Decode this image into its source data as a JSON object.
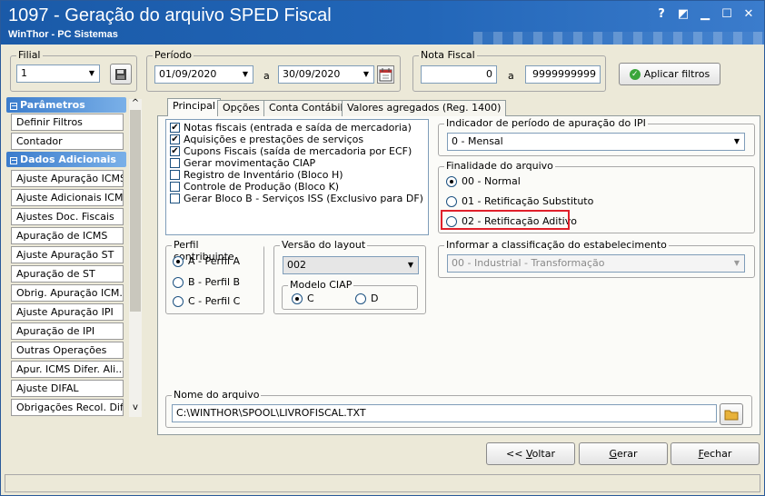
{
  "window": {
    "title": "1097 - Geração do arquivo SPED Fiscal",
    "subtitle": "WinThor - PC Sistemas",
    "help_glyph": "?",
    "restore_glyph": "◩",
    "min_glyph": "▁",
    "max_glyph": "☐",
    "close_glyph": "✕"
  },
  "filial": {
    "legend": "Filial",
    "value": "1"
  },
  "periodo": {
    "legend": "Período",
    "start": "01/09/2020",
    "sep": "a",
    "end": "30/09/2020"
  },
  "nota_fiscal": {
    "legend": "Nota Fiscal",
    "start": "0",
    "sep": "a",
    "end": "9999999999"
  },
  "apply_filters": {
    "label": "Aplicar filtros"
  },
  "sidebar": {
    "section1": "Parâmetros",
    "section1_items": [
      "Definir Filtros",
      "Contador"
    ],
    "section2": "Dados Adicionais",
    "section2_items": [
      "Ajuste Apuração ICMS",
      "Ajuste Adicionais ICMS",
      "Ajustes Doc. Fiscais",
      "Apuração de ICMS",
      "Ajuste Apuração ST",
      "Apuração de ST",
      "Obrig. Apuração ICM...",
      "Ajuste Apuração IPI",
      "Apuração de IPI",
      "Outras Operações",
      "Apur. ICMS Difer. Ali...",
      "Ajuste DIFAL",
      "Obrigações Recol. Difal"
    ]
  },
  "tabs": [
    "Principal",
    "Opções",
    "Conta Contábil",
    "Valores agregados (Reg. 1400)"
  ],
  "checklist": [
    {
      "label": "Notas fiscais (entrada e saída de mercadoria)",
      "checked": true
    },
    {
      "label": "Aquisições e prestações de serviços",
      "checked": true
    },
    {
      "label": "Cupons Fiscais (saída de mercadoria por ECF)",
      "checked": true
    },
    {
      "label": "Gerar movimentação CIAP",
      "checked": false
    },
    {
      "label": "Registro de Inventário (Bloco H)",
      "checked": false
    },
    {
      "label": "Controle de Produção (Bloco K)",
      "checked": false
    },
    {
      "label": "Gerar Bloco B - Serviços ISS (Exclusivo para DF)",
      "checked": false
    }
  ],
  "indicador_ipi": {
    "legend": "Indicador de período de apuração do IPI",
    "value": "0 - Mensal"
  },
  "finalidade": {
    "legend": "Finalidade do arquivo",
    "options": [
      "00 - Normal",
      "01 - Retificação Substituto",
      "02 - Retificação Aditivo"
    ],
    "selected": 0
  },
  "perfil": {
    "legend": "Perfil contribuinte",
    "options": [
      "A - Perfil A",
      "B - Perfil B",
      "C - Perfil C"
    ],
    "selected": 0
  },
  "versao_layout": {
    "legend": "Versão do layout",
    "value": "002"
  },
  "modelo_ciap": {
    "legend": "Modelo CIAP",
    "options": [
      "C",
      "D"
    ],
    "selected": 0
  },
  "classificacao": {
    "legend": "Informar a classificação do estabelecimento",
    "value": "00 - Industrial - Transformação"
  },
  "nome_arquivo": {
    "legend": "Nome do arquivo",
    "value": "C:\\WINTHOR\\SPOOL\\LIVROFISCAL.TXT"
  },
  "buttons": {
    "voltar_pre": "<< ",
    "voltar_u": "V",
    "voltar_post": "oltar",
    "gerar_u": "G",
    "gerar_post": "erar",
    "fechar_u": "F",
    "fechar_post": "echar"
  }
}
